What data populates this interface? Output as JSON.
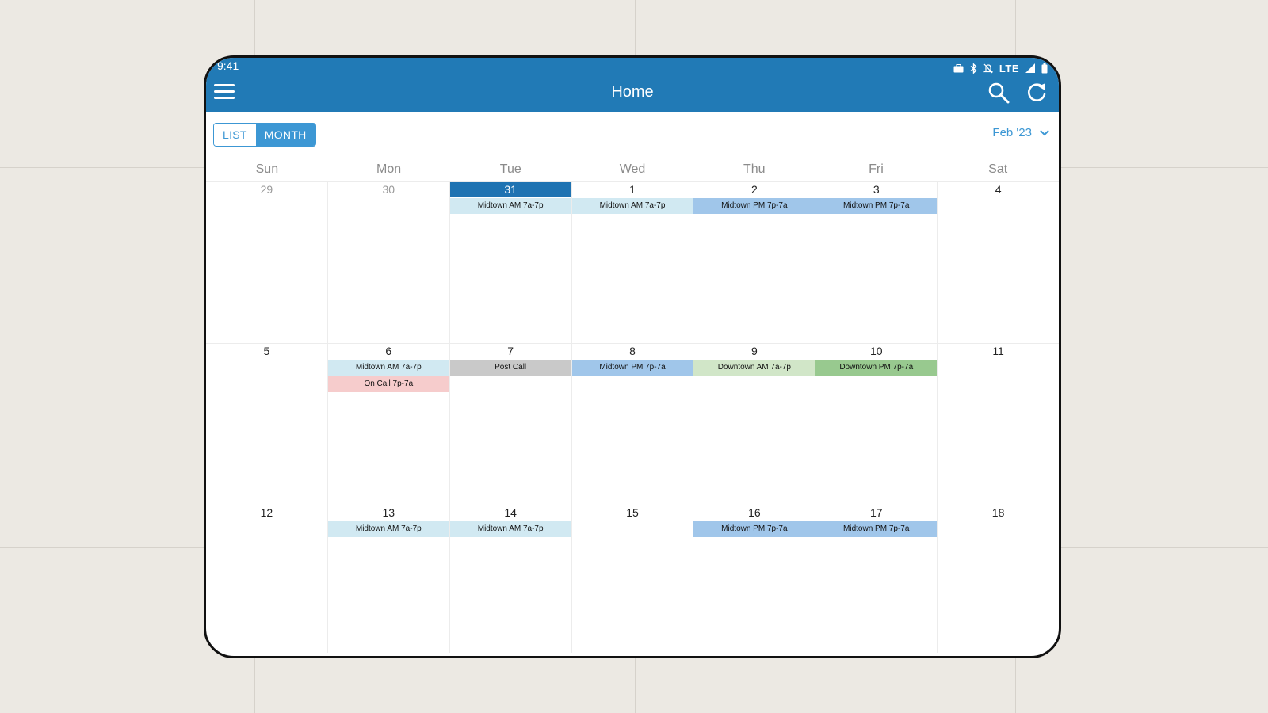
{
  "status_bar": {
    "time": "9:41",
    "network": "LTE"
  },
  "header": {
    "title": "Home"
  },
  "view_toggle": {
    "list_label": "LIST",
    "month_label": "MONTH",
    "selected": "MONTH"
  },
  "month_selector": {
    "label": "Feb '23"
  },
  "days_of_week": [
    "Sun",
    "Mon",
    "Tue",
    "Wed",
    "Thu",
    "Fri",
    "Sat"
  ],
  "colors": {
    "app_bar": "#217ab6",
    "accent": "#3c97d4",
    "today": "#1f73b2",
    "event_light": "#d1e9f2",
    "event_blue": "#a0c6ea",
    "event_gray": "#c9c9c9",
    "event_pink": "#f6cccc",
    "event_light_green": "#d1e6c8",
    "event_green": "#98c98f"
  },
  "weeks": [
    [
      {
        "day": "29",
        "muted": true,
        "events": []
      },
      {
        "day": "30",
        "muted": true,
        "events": []
      },
      {
        "day": "31",
        "today": true,
        "events": [
          {
            "label": "Midtown AM 7a-7p",
            "color": "light"
          }
        ]
      },
      {
        "day": "1",
        "events": [
          {
            "label": "Midtown AM 7a-7p",
            "color": "light"
          }
        ]
      },
      {
        "day": "2",
        "events": [
          {
            "label": "Midtown PM 7p-7a",
            "color": "blue"
          }
        ]
      },
      {
        "day": "3",
        "events": [
          {
            "label": "Midtown PM 7p-7a",
            "color": "blue"
          }
        ]
      },
      {
        "day": "4",
        "events": []
      }
    ],
    [
      {
        "day": "5",
        "events": []
      },
      {
        "day": "6",
        "events": [
          {
            "label": "Midtown AM 7a-7p",
            "color": "light"
          },
          {
            "label": "On Call 7p-7a",
            "color": "pink"
          }
        ]
      },
      {
        "day": "7",
        "events": [
          {
            "label": "Post Call",
            "color": "gray"
          }
        ]
      },
      {
        "day": "8",
        "events": [
          {
            "label": "Midtown PM 7p-7a",
            "color": "blue"
          }
        ]
      },
      {
        "day": "9",
        "events": [
          {
            "label": "Downtown AM 7a-7p",
            "color": "lgreen"
          }
        ]
      },
      {
        "day": "10",
        "events": [
          {
            "label": "Downtown PM 7p-7a",
            "color": "green"
          }
        ]
      },
      {
        "day": "11",
        "events": []
      }
    ],
    [
      {
        "day": "12",
        "events": []
      },
      {
        "day": "13",
        "events": [
          {
            "label": "Midtown AM 7a-7p",
            "color": "light"
          }
        ]
      },
      {
        "day": "14",
        "events": [
          {
            "label": "Midtown AM 7a-7p",
            "color": "light"
          }
        ]
      },
      {
        "day": "15",
        "events": []
      },
      {
        "day": "16",
        "events": [
          {
            "label": "Midtown PM 7p-7a",
            "color": "blue"
          }
        ]
      },
      {
        "day": "17",
        "events": [
          {
            "label": "Midtown PM 7p-7a",
            "color": "blue"
          }
        ]
      },
      {
        "day": "18",
        "events": []
      }
    ]
  ]
}
